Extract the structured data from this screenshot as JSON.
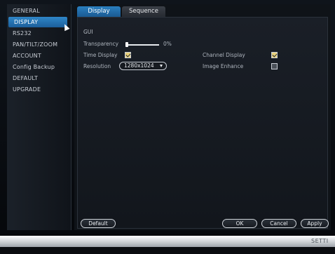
{
  "sidebar": {
    "items": [
      {
        "label": "GENERAL"
      },
      {
        "label": "DISPLAY"
      },
      {
        "label": "RS232"
      },
      {
        "label": "PAN/TILT/ZOOM"
      },
      {
        "label": "ACCOUNT"
      },
      {
        "label": "Config Backup"
      },
      {
        "label": "DEFAULT"
      },
      {
        "label": "UPGRADE"
      }
    ],
    "active_index": 1
  },
  "tabs": [
    {
      "label": "Display",
      "active": true
    },
    {
      "label": "Sequence",
      "active": false
    }
  ],
  "gui": {
    "section_title": "GUI",
    "transparency": {
      "label": "Transparency",
      "value_text": "0%",
      "value": 0
    },
    "time_display": {
      "label": "Time Display",
      "checked": true
    },
    "resolution": {
      "label": "Resolution",
      "selected": "1280x1024"
    },
    "channel_display": {
      "label": "Channel Display",
      "checked": true
    },
    "image_enhance": {
      "label": "Image Enhance",
      "checked": false
    }
  },
  "buttons": {
    "default": "Default",
    "ok": "OK",
    "cancel": "Cancel",
    "apply": "Apply"
  },
  "bottom_bar": {
    "label": "SETTI"
  },
  "colors": {
    "accent": "#2a7fc0",
    "checkbox_checked": "#e9d27c"
  }
}
